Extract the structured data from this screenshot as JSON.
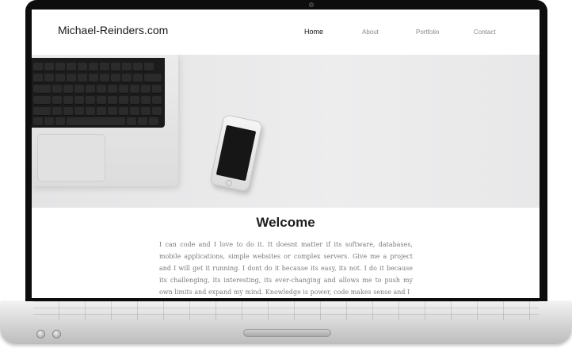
{
  "site": {
    "logo": "Michael-Reinders.com",
    "nav": [
      {
        "label": "Home",
        "active": true
      },
      {
        "label": "About",
        "active": false
      },
      {
        "label": "Portfolio",
        "active": false
      },
      {
        "label": "Contact",
        "active": false
      }
    ]
  },
  "welcome": {
    "title": "Welcome",
    "text": "I can code and I love to do it. It doesnt matter if its software, databases, mobile applications, simple websites or complex servers. Give me a project and I will get it running. I dont do it because its easy, its not. I do it because its challenging, its interesting, its ever-changing and allows me to push my own limits and expand my mind. Knowledge is power, code makes sense and I"
  },
  "colors": {
    "bezel": "#0d0d0d",
    "hero_background": "#e8e8e9",
    "text_muted": "#7a7a7a",
    "nav_active": "#111111",
    "nav_inactive": "#888888"
  }
}
